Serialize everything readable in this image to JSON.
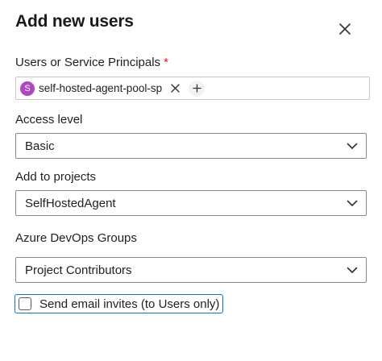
{
  "dialog": {
    "title": "Add new users",
    "close_icon": "close-icon"
  },
  "users_field": {
    "label": "Users or Service Principals",
    "required_marker": "*",
    "selected": [
      {
        "avatar_initial": "S",
        "name": "self-hosted-agent-pool-sp",
        "avatar_color": "#b146c2"
      }
    ],
    "add_icon": "plus-icon"
  },
  "access_level": {
    "label": "Access level",
    "value": "Basic"
  },
  "projects": {
    "label": "Add to projects",
    "value": "SelfHostedAgent"
  },
  "groups": {
    "label": "Azure DevOps Groups",
    "value": "Project Contributors"
  },
  "email_invites": {
    "label": "Send email invites (to Users only)",
    "checked": false
  },
  "colors": {
    "required": "#cd1f1f",
    "focus_border": "#0078d4"
  }
}
